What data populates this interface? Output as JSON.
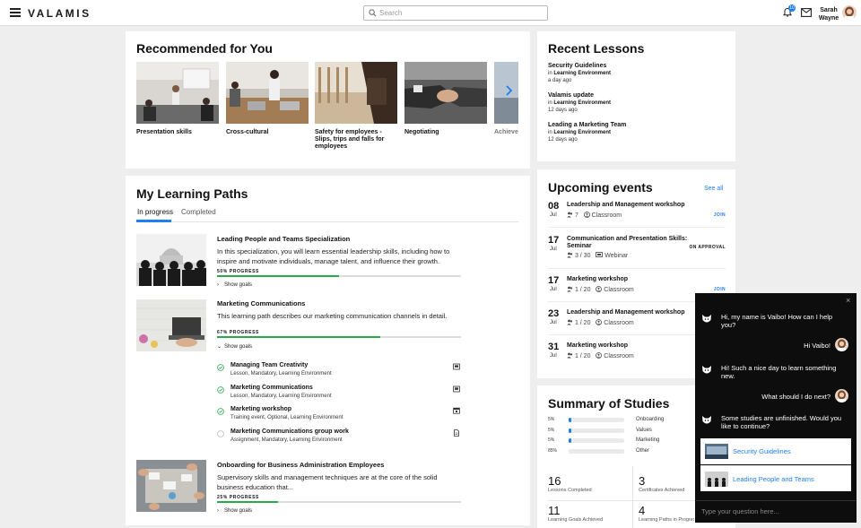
{
  "header": {
    "logo": "VALAMIS",
    "search_placeholder": "Search",
    "notifications_count": "10",
    "user_first": "Sarah",
    "user_last": "Wayne"
  },
  "recommended": {
    "title": "Recommended for You",
    "items": [
      {
        "label": "Presentation skills"
      },
      {
        "label": "Cross-cultural"
      },
      {
        "label": "Safety for employees - Slips, trips and falls for employees"
      },
      {
        "label": "Negotiating"
      },
      {
        "label": "Achieve commu"
      }
    ]
  },
  "learning_paths": {
    "title": "My Learning Paths",
    "tabs": [
      {
        "label": "In progress"
      },
      {
        "label": "Completed"
      }
    ],
    "paths": [
      {
        "title": "Leading People and Teams Specialization",
        "description": "In this specialization, you will learn essential leadership skills, including how to inspire and motivate individuals, manage talent, and influence their growth.",
        "progress_label": "50% PROGRESS",
        "progress": 0.5,
        "goals_label": "Show goals"
      },
      {
        "title": "Marketing Communications",
        "description": "This learning path describes our marketing communication channels in detail.",
        "progress_label": "67% PROGRESS",
        "progress": 0.67,
        "goals_label": "Show goals",
        "goals": [
          {
            "title": "Managing Team Creativity",
            "sub": "Lesson, Mandatory, Learning Environment",
            "done": true,
            "icon": "lesson-icon"
          },
          {
            "title": "Marketing Communications",
            "sub": "Lesson, Mandatory, Learning Environment",
            "done": true,
            "icon": "lesson-icon"
          },
          {
            "title": "Marketing workshop",
            "sub": "Training event, Optional, Learning Environment",
            "done": true,
            "icon": "calendar-icon"
          },
          {
            "title": "Marketing Communications group work",
            "sub": "Assignment, Mandatory, Learning Environment",
            "done": false,
            "icon": "document-icon"
          }
        ]
      },
      {
        "title": "Onboarding for Business Administration Employees",
        "description": "Supervisory skills and management techniques are at the core of the solid business education that...",
        "progress_label": "25% PROGRESS",
        "progress": 0.25,
        "goals_label": "Show goals"
      }
    ]
  },
  "recent_lessons": {
    "title": "Recent Lessons",
    "in_label": "in",
    "items": [
      {
        "title": "Security Guidelines",
        "env": "Learning Environment",
        "when": "a day ago"
      },
      {
        "title": "Valamis update",
        "env": "Learning Environment",
        "when": "12 days ago"
      },
      {
        "title": "Leading a Marketing Team",
        "env": "Learning Environment",
        "when": "12 days ago"
      }
    ]
  },
  "events": {
    "title": "Upcoming events",
    "see_all": "See all",
    "items": [
      {
        "day": "08",
        "month": "Jul",
        "title": "Leadership and Management workshop",
        "seats": "7",
        "type": "Classroom",
        "action": "JOIN",
        "action_style": "blue"
      },
      {
        "day": "17",
        "month": "Jul",
        "title": "Communication and Presentation Skills: Seminar",
        "seats": "3 / 30",
        "type": "Webinar",
        "action": "ON APPROVAL",
        "action_style": "dark"
      },
      {
        "day": "17",
        "month": "Jul",
        "title": "Marketing workshop",
        "seats": "1 / 20",
        "type": "Classroom",
        "action": "JOIN",
        "action_style": "blue"
      },
      {
        "day": "23",
        "month": "Jul",
        "title": "Leadership and Management workshop",
        "seats": "1 / 20",
        "type": "Classroom",
        "action": "",
        "action_style": "blue"
      },
      {
        "day": "31",
        "month": "Jul",
        "title": "Marketing workshop",
        "seats": "1 / 20",
        "type": "Classroom",
        "action": "",
        "action_style": "blue"
      }
    ]
  },
  "summary": {
    "title": "Summary of Studies",
    "rows": [
      {
        "pct": "5%",
        "value": 0.05,
        "label": "Onboarding"
      },
      {
        "pct": "5%",
        "value": 0.05,
        "label": "Values"
      },
      {
        "pct": "5%",
        "value": 0.05,
        "label": "Marketing"
      },
      {
        "pct": "85%",
        "value": 0.85,
        "label": "Other"
      }
    ],
    "stats": [
      {
        "value": "16",
        "label": "Lessons Completed"
      },
      {
        "value": "3",
        "label": "Certificates Achieved"
      },
      {
        "value": "11",
        "label": "Learning Goals Achieved"
      },
      {
        "value": "4",
        "label": "Learning Paths in Progress"
      }
    ]
  },
  "chat": {
    "close": "×",
    "messages": [
      {
        "from": "bot",
        "text": "Hi, my name is Vaibo! How can I help you?"
      },
      {
        "from": "user",
        "text": "Hi Vaibo!"
      },
      {
        "from": "bot",
        "text": "Hi! Such a nice day to learn something new."
      },
      {
        "from": "user",
        "text": "What should I do next?"
      },
      {
        "from": "bot",
        "text": "Some studies are unfinished. Would you like to continue?"
      }
    ],
    "suggestions": [
      {
        "label": "Security Guidelines"
      },
      {
        "label": "Leading People and Teams"
      }
    ],
    "input_placeholder": "Type your question here..."
  },
  "colors": {
    "accent": "#1e7ff0",
    "progress": "#2aa84a",
    "chat_bg": "#0d0d0d"
  }
}
